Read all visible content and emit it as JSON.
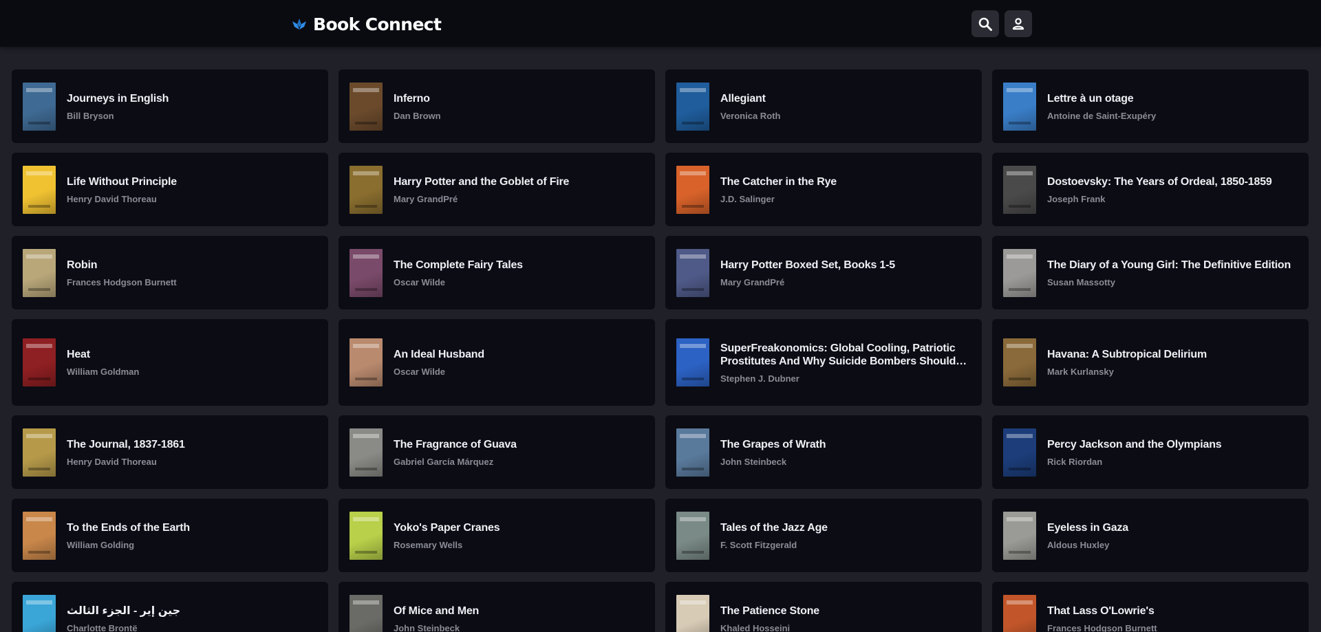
{
  "app": {
    "brand_name": "Book Connect",
    "brand_color": "#2f8ce6",
    "icons": {
      "logo": "book-connect-logo-icon",
      "search": "search-icon",
      "account": "person-icon"
    }
  },
  "books": [
    {
      "title": "Journeys in English",
      "author": "Bill Bryson",
      "cover_color": "#3f6a93"
    },
    {
      "title": "Inferno",
      "author": "Dan Brown",
      "cover_color": "#6b4a2c"
    },
    {
      "title": "Allegiant",
      "author": "Veronica Roth",
      "cover_color": "#1f5d9c"
    },
    {
      "title": "Lettre à un otage",
      "author": "Antoine de Saint-Exupéry",
      "cover_color": "#3a7ec8"
    },
    {
      "title": "Life Without Principle",
      "author": "Henry David Thoreau",
      "cover_color": "#f0c232"
    },
    {
      "title": "Harry Potter and the Goblet of Fire",
      "author": "Mary GrandPré",
      "cover_color": "#8a6e2f"
    },
    {
      "title": "The Catcher in the Rye",
      "author": "J.D. Salinger",
      "cover_color": "#d8622a"
    },
    {
      "title": "Dostoevsky: The Years of Ordeal, 1850-1859",
      "author": "Joseph Frank",
      "cover_color": "#4a4a4a"
    },
    {
      "title": "Robin",
      "author": "Frances Hodgson Burnett",
      "cover_color": "#b9a77a"
    },
    {
      "title": "The Complete Fairy Tales",
      "author": "Oscar Wilde",
      "cover_color": "#7a4a6a"
    },
    {
      "title": "Harry Potter Boxed Set, Books 1-5",
      "author": "Mary GrandPré",
      "cover_color": "#4f5a88"
    },
    {
      "title": "The Diary of a Young Girl: The Definitive Edition",
      "author": "Susan Massotty",
      "cover_color": "#9c9a98"
    },
    {
      "title": "Heat",
      "author": "William Goldman",
      "cover_color": "#8e1f22"
    },
    {
      "title": "An Ideal Husband",
      "author": "Oscar Wilde",
      "cover_color": "#b98a6e"
    },
    {
      "title": "SuperFreakonomics: Global Cooling, Patriotic Prostitutes And Why Suicide Bombers Should Buy Life Insurance",
      "author": "Stephen J. Dubner",
      "cover_color": "#2c62c4"
    },
    {
      "title": "Havana: A Subtropical Delirium",
      "author": "Mark Kurlansky",
      "cover_color": "#8a6a3a"
    },
    {
      "title": "The Journal, 1837-1861",
      "author": "Henry David Thoreau",
      "cover_color": "#b69a4a"
    },
    {
      "title": "The Fragrance of Guava",
      "author": "Gabriel García Márquez",
      "cover_color": "#8a8a86"
    },
    {
      "title": "The Grapes of Wrath",
      "author": "John Steinbeck",
      "cover_color": "#5a7a9c"
    },
    {
      "title": "Percy Jackson and the Olympians",
      "author": "Rick Riordan",
      "cover_color": "#1c3d7a"
    },
    {
      "title": "To the Ends of the Earth",
      "author": "William Golding",
      "cover_color": "#c9874a"
    },
    {
      "title": "Yoko's Paper Cranes",
      "author": "Rosemary Wells",
      "cover_color": "#b8d04a"
    },
    {
      "title": "Tales of the Jazz Age",
      "author": "F. Scott Fitzgerald",
      "cover_color": "#7a8a86"
    },
    {
      "title": "Eyeless in Gaza",
      "author": "Aldous Huxley",
      "cover_color": "#9a9a96"
    },
    {
      "title": "جين إير - الجزء الثالث",
      "author": "Charlotte Brontë",
      "cover_color": "#3aa6d8"
    },
    {
      "title": "Of Mice and Men",
      "author": "John Steinbeck",
      "cover_color": "#6a6a66"
    },
    {
      "title": "The Patience Stone",
      "author": "Khaled Hosseini",
      "cover_color": "#d8cbb6"
    },
    {
      "title": "That Lass O'Lowrie's",
      "author": "Frances Hodgson Burnett",
      "cover_color": "#c2562a"
    }
  ]
}
